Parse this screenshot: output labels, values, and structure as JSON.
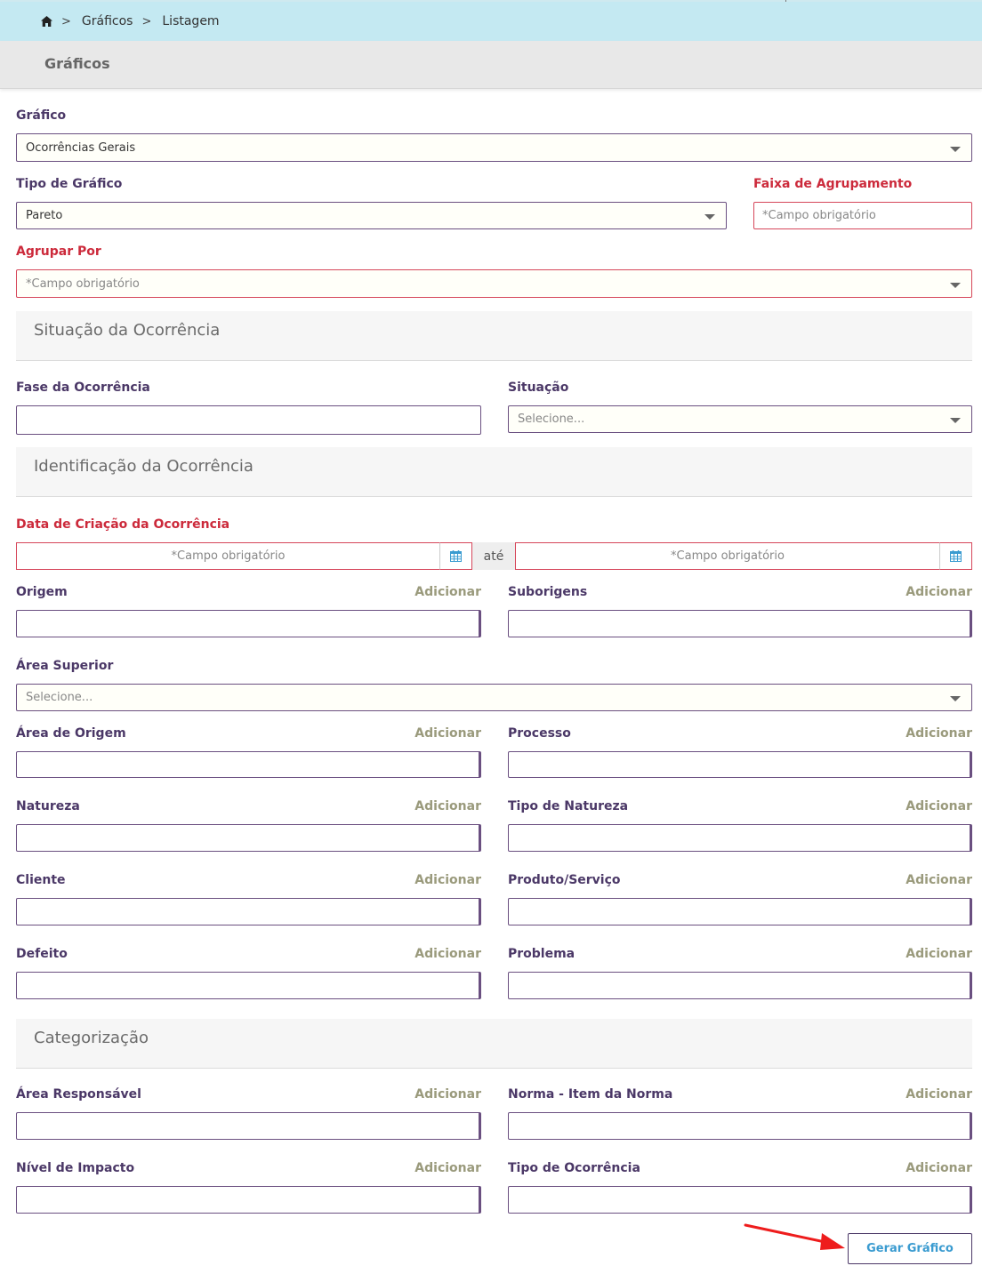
{
  "breadcrumb": {
    "items": [
      "Gráficos",
      "Listagem"
    ],
    "separator": ">"
  },
  "page": {
    "title": "Gráficos"
  },
  "form": {
    "grafico": {
      "label": "Gráfico",
      "value": "Ocorrências Gerais"
    },
    "tipo_grafico": {
      "label": "Tipo de Gráfico",
      "value": "Pareto"
    },
    "faixa_agrupamento": {
      "label": "Faixa de Agrupamento",
      "placeholder": "*Campo obrigatório"
    },
    "agrupar_por": {
      "label": "Agrupar Por",
      "placeholder": "*Campo obrigatório"
    }
  },
  "sections": {
    "situacao": {
      "title": "Situação da Ocorrência",
      "fase": {
        "label": "Fase da Ocorrência"
      },
      "situacao": {
        "label": "Situação",
        "placeholder": "Selecione..."
      }
    },
    "identificacao": {
      "title": "Identificação da Ocorrência",
      "data_criacao": {
        "label": "Data de Criação da Ocorrência",
        "from_placeholder": "*Campo obrigatório",
        "to_placeholder": "*Campo obrigatório",
        "between": "até"
      },
      "origem": {
        "label": "Origem",
        "action": "Adicionar"
      },
      "suborigens": {
        "label": "Suborigens",
        "action": "Adicionar"
      },
      "area_superior": {
        "label": "Área Superior",
        "placeholder": "Selecione..."
      },
      "area_origem": {
        "label": "Área de Origem",
        "action": "Adicionar"
      },
      "processo": {
        "label": "Processo",
        "action": "Adicionar"
      },
      "natureza": {
        "label": "Natureza",
        "action": "Adicionar"
      },
      "tipo_natureza": {
        "label": "Tipo de Natureza",
        "action": "Adicionar"
      },
      "cliente": {
        "label": "Cliente",
        "action": "Adicionar"
      },
      "produto_servico": {
        "label": "Produto/Serviço",
        "action": "Adicionar"
      },
      "defeito": {
        "label": "Defeito",
        "action": "Adicionar"
      },
      "problema": {
        "label": "Problema",
        "action": "Adicionar"
      }
    },
    "categorizacao": {
      "title": "Categorização",
      "area_responsavel": {
        "label": "Área Responsável",
        "action": "Adicionar"
      },
      "norma_item": {
        "label": "Norma - Item da Norma",
        "action": "Adicionar"
      },
      "nivel_impacto": {
        "label": "Nível de Impacto",
        "action": "Adicionar"
      },
      "tipo_ocorrencia": {
        "label": "Tipo de Ocorrência",
        "action": "Adicionar"
      }
    }
  },
  "actions": {
    "generate_label": "Gerar Gráfico"
  },
  "colors": {
    "breadcrumb_bg": "#c4e9f2",
    "label": "#4b3867",
    "required": "#cc2a3b",
    "action": "#9a9a7c",
    "button_text": "#3a9bd0",
    "annotation_arrow": "#ee1c1c"
  },
  "icons": [
    "home-icon",
    "calendar-icon",
    "chevron-down-icon",
    "red-arrow-annotation"
  ]
}
